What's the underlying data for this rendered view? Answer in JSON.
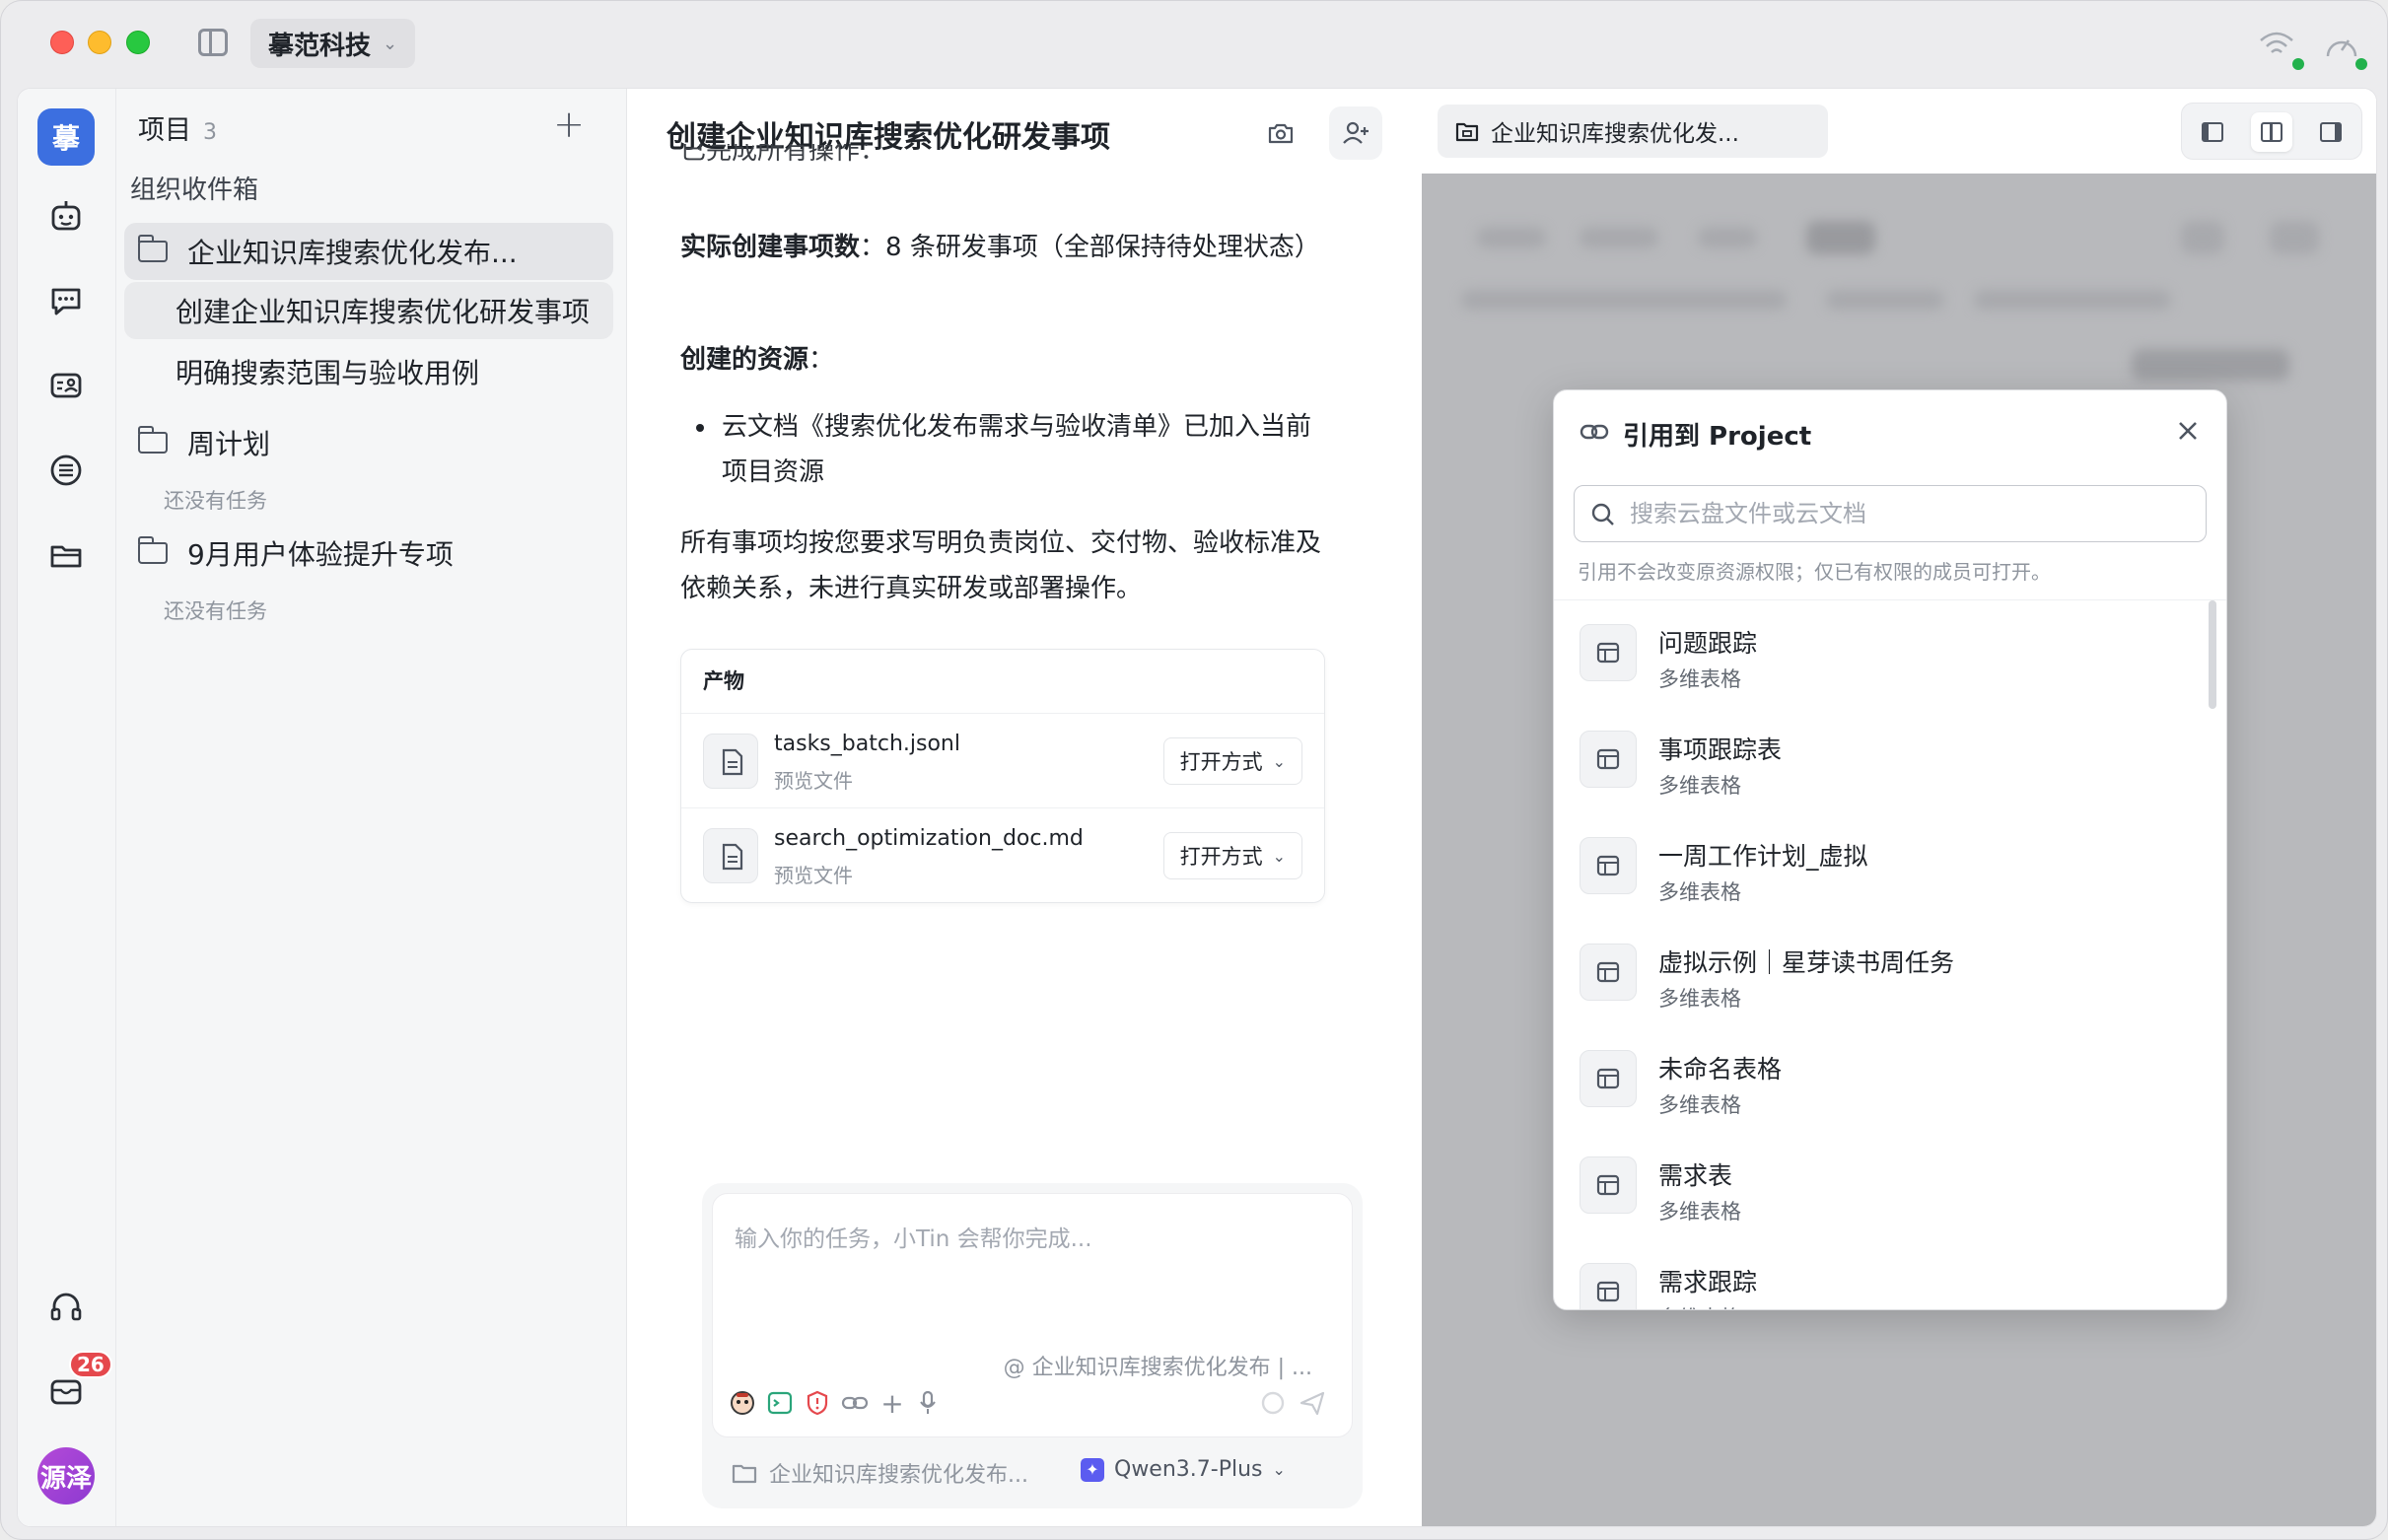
{
  "titlebar": {
    "org_name": "摹范科技"
  },
  "rail": {
    "logo_char": "摹",
    "inbox_badge": "26",
    "avatar_label": "源泽",
    "icons": [
      "robot-icon",
      "chat-icon",
      "contacts-icon",
      "list-icon",
      "folder-icon",
      "headset-icon",
      "mail-icon"
    ]
  },
  "projects": {
    "header": "项目",
    "count": "3",
    "inbox_label": "组织收件箱",
    "items": [
      {
        "label": "企业知识库搜索优化发布...",
        "type": "folder",
        "selected": true
      },
      {
        "label": "创建企业知识库搜索优化研发事项",
        "type": "task",
        "active": true
      },
      {
        "label": "明确搜索范围与验收用例",
        "type": "task"
      },
      {
        "label": "周计划",
        "type": "folder",
        "note": "还没有任务"
      },
      {
        "label": "9月用户体验提升专项",
        "type": "folder",
        "note": "还没有任务"
      }
    ]
  },
  "chat": {
    "title": "创建企业知识库搜索优化研发事项",
    "cut_line": "已完成所有操作：",
    "stat_label": "实际创建事项数",
    "stat_value": "：8 条研发事项（全部保持待处理状态）",
    "resources_label": "创建的资源",
    "resources_colon": "：",
    "bullet": "云文档《搜索优化发布需求与验收清单》已加入当前项目资源",
    "summary": "所有事项均按您要求写明负责岗位、交付物、验收标准及依赖关系，未进行真实研发或部署操作。",
    "artifacts": {
      "header": "产物",
      "files": [
        {
          "name": "tasks_batch.jsonl",
          "sub": "预览文件",
          "action": "打开方式"
        },
        {
          "name": "search_optimization_doc.md",
          "sub": "预览文件",
          "action": "打开方式"
        }
      ]
    },
    "composer": {
      "placeholder": "输入你的任务，小Tin 会帮你完成...",
      "context_ref": "@ 企业知识库搜索优化发布 | ...",
      "project_label": "企业知识库搜索优化发布...",
      "model": "Qwen3.7-Plus"
    }
  },
  "preview": {
    "tab_label": "企业知识库搜索优化发..."
  },
  "modal": {
    "title": "引用到 Project",
    "search_placeholder": "搜索云盘文件或云文档",
    "hint": "引用不会改变原资源权限；仅已有权限的成员可打开。",
    "items": [
      {
        "name": "问题跟踪",
        "type": "多维表格"
      },
      {
        "name": "事项跟踪表",
        "type": "多维表格"
      },
      {
        "name": "一周工作计划_虚拟",
        "type": "多维表格"
      },
      {
        "name": "虚拟示例｜星芽读书周任务",
        "type": "多维表格"
      },
      {
        "name": "未命名表格",
        "type": "多维表格"
      },
      {
        "name": "需求表",
        "type": "多维表格"
      },
      {
        "name": "需求跟踪",
        "type": "多维表格"
      }
    ]
  }
}
